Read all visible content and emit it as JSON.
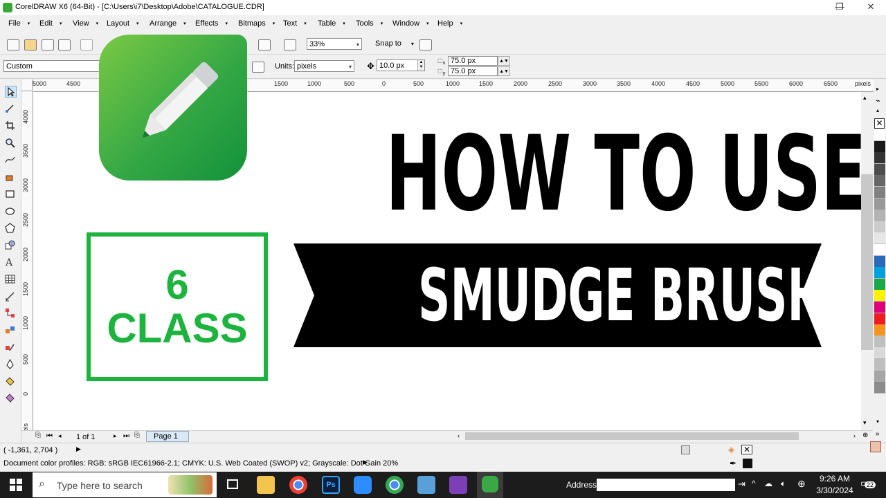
{
  "window": {
    "title": "CorelDRAW X6 (64-Bit) - [C:\\Users\\i7\\Desktop\\Adobe\\CATALOGUE.CDR]",
    "minimize": "—",
    "restore": "❐",
    "close": "✕"
  },
  "menu": [
    "File",
    "Edit",
    "View",
    "Layout",
    "Arrange",
    "Effects",
    "Bitmaps",
    "Text",
    "Table",
    "Tools",
    "Window",
    "Help"
  ],
  "toolbar": {
    "zoom": "33%",
    "snap_to": "Snap to"
  },
  "propertybar": {
    "page_preset": "Custom",
    "units_label": "Units:",
    "units": "pixels",
    "nudge": "10.0 px",
    "dup_x": "75.0 px",
    "dup_y": "75.0 px",
    "x_sub": "x",
    "y_sub": "y"
  },
  "ruler": {
    "top_ticks": [
      "5000",
      "4500",
      "1500",
      "1000",
      "500",
      "0",
      "500",
      "1000",
      "1500",
      "2000",
      "2500",
      "3000",
      "3500",
      "4000",
      "4500",
      "5000",
      "5500",
      "6000",
      "6500"
    ],
    "top_unit": "pixels",
    "left_ticks": [
      "4000",
      "3500",
      "3000",
      "2500",
      "2000",
      "1500",
      "1000",
      "500",
      "0"
    ],
    "left_unit": "pixels"
  },
  "artwork": {
    "class_number": "6",
    "class_word": "CLASS",
    "headline": "HOW TO USE",
    "banner": "SMUDGE BRUSH"
  },
  "pages": {
    "counter": "1 of 1",
    "tab": "Page 1"
  },
  "status": {
    "coords": "( -1,361, 2,704 )",
    "profiles": "Document color profiles: RGB: sRGB IEC61966-2.1; CMYK: U.S. Web Coated (SWOP) v2; Grayscale: Dot Gain 20%"
  },
  "palette": [
    "#ffffff",
    "#1a1a1a",
    "#333333",
    "#4d4d4d",
    "#666666",
    "#808080",
    "#999999",
    "#b3b3b3",
    "#cccccc",
    "#e6e6e6",
    "#ffffff",
    "#2b6ab8",
    "#00a0e0",
    "#19a84a",
    "#fff200",
    "#e0007a",
    "#ed1c24",
    "#f7941d",
    "#c0c0c0",
    "#d9d9d9",
    "#bfbfbf",
    "#a6a6a6",
    "#8c8c8c"
  ],
  "taskbar": {
    "search_placeholder": "Type here to search",
    "address_label": "Address",
    "time": "9:26 AM",
    "date": "3/30/2024",
    "notifications": "22"
  },
  "colors": {
    "class_green": "#1db33f",
    "logo_green": "#35a845"
  }
}
